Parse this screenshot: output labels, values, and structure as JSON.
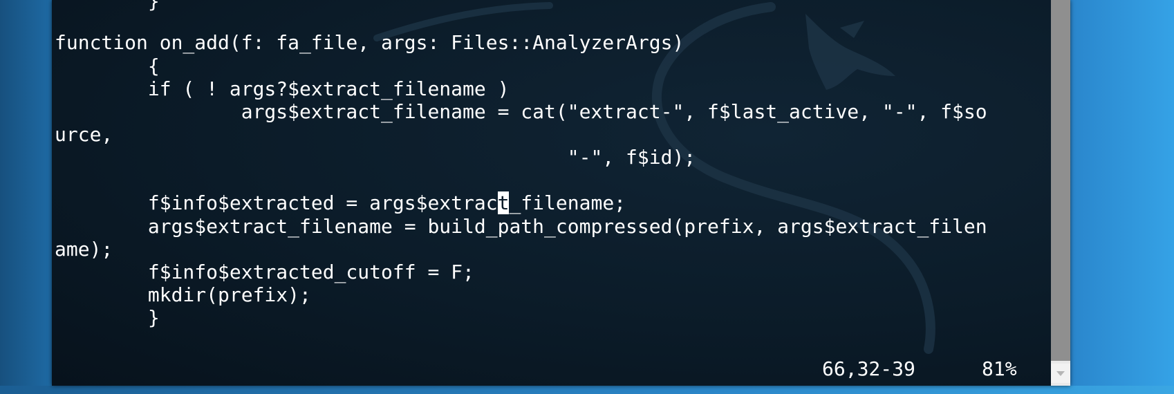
{
  "editor": {
    "lines": [
      "        }",
      "",
      "function on_add(f: fa_file, args: Files::AnalyzerArgs)",
      "        {",
      "        if ( ! args?$extract_filename )",
      "                args$extract_filename = cat(\"extract-\", f$last_active, \"-\", f$so",
      "urce,",
      "                                            \"-\", f$id);",
      "",
      "        f$info$extracted = args$extrac",
      "        args$extract_filename = build_path_compressed(prefix, args$extract_filen",
      "ame);",
      "        f$info$extracted_cutoff = F;",
      "        mkdir(prefix);",
      "        }"
    ],
    "cursor_char": "t",
    "cursor_line_rest": "_filename;"
  },
  "status": {
    "position": "66,32-39",
    "percent": "81%"
  },
  "colors": {
    "text": "#ffffff",
    "background": "#0b1b28",
    "desktop": "#2a77b8"
  },
  "icons": {
    "scroll_down": "triangle-down-icon",
    "wallpaper": "dragon-logo"
  }
}
